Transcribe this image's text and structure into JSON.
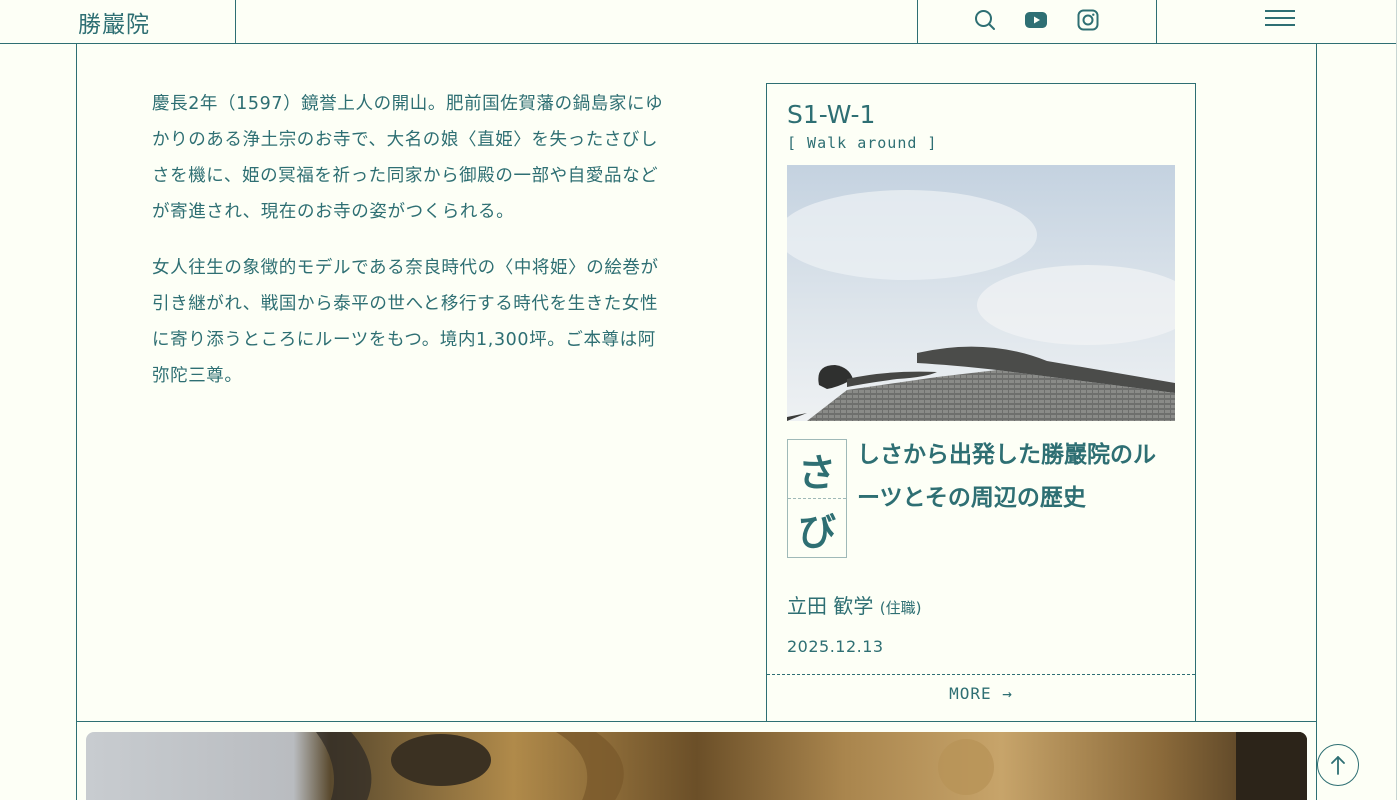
{
  "header": {
    "logo": "勝巖院",
    "icons": [
      "search-icon",
      "youtube-icon",
      "instagram-icon",
      "menu-icon"
    ]
  },
  "intro": {
    "paragraphs": [
      "慶長2年（1597）鏡誉上人の開山。肥前国佐賀藩の鍋島家にゆかりのある浄土宗のお寺で、大名の娘〈直姫〉を失ったさびしさを機に、姫の冥福を祈った同家から御殿の一部や自愛品などが寄進され、現在のお寺の姿がつくられる。",
      "女人往生の象徴的モデルである奈良時代の〈中将姫〉の絵巻が引き継がれ、戦国から泰平の世へと移行する時代を生きた女性に寄り添うところにルーツをもつ。境内1,300坪。ご本尊は阿弥陀三尊。"
    ]
  },
  "card": {
    "code": "S1-W-1",
    "subtitle": "[ Walk around ]",
    "kana": [
      "さ",
      "び"
    ],
    "title": "しさから出発した勝巖院のルーツとその周辺の歴史",
    "author": "立田 歓学",
    "author_role": "(住職)",
    "date": "2025.12.13",
    "more_label": "MORE →"
  },
  "colors": {
    "primary": "#2e6f73",
    "background": "#fdfff6"
  }
}
